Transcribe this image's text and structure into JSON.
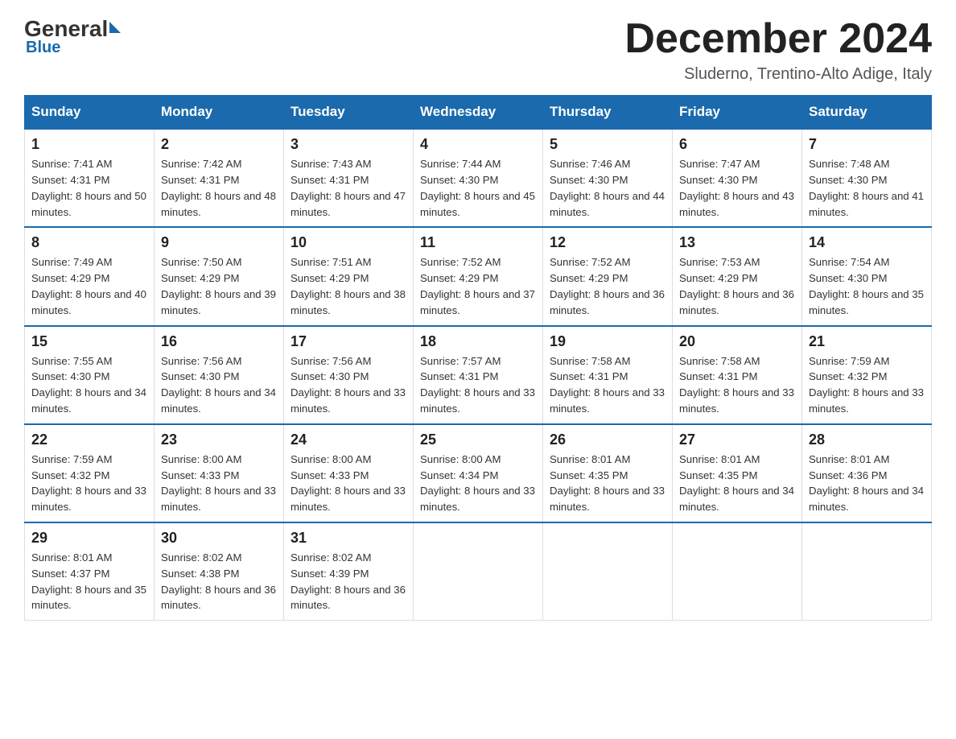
{
  "logo": {
    "general": "General",
    "arrow": "",
    "blue": "Blue"
  },
  "header": {
    "month": "December 2024",
    "location": "Sluderno, Trentino-Alto Adige, Italy"
  },
  "weekdays": [
    "Sunday",
    "Monday",
    "Tuesday",
    "Wednesday",
    "Thursday",
    "Friday",
    "Saturday"
  ],
  "weeks": [
    [
      {
        "day": "1",
        "sunrise": "7:41 AM",
        "sunset": "4:31 PM",
        "daylight": "8 hours and 50 minutes."
      },
      {
        "day": "2",
        "sunrise": "7:42 AM",
        "sunset": "4:31 PM",
        "daylight": "8 hours and 48 minutes."
      },
      {
        "day": "3",
        "sunrise": "7:43 AM",
        "sunset": "4:31 PM",
        "daylight": "8 hours and 47 minutes."
      },
      {
        "day": "4",
        "sunrise": "7:44 AM",
        "sunset": "4:30 PM",
        "daylight": "8 hours and 45 minutes."
      },
      {
        "day": "5",
        "sunrise": "7:46 AM",
        "sunset": "4:30 PM",
        "daylight": "8 hours and 44 minutes."
      },
      {
        "day": "6",
        "sunrise": "7:47 AM",
        "sunset": "4:30 PM",
        "daylight": "8 hours and 43 minutes."
      },
      {
        "day": "7",
        "sunrise": "7:48 AM",
        "sunset": "4:30 PM",
        "daylight": "8 hours and 41 minutes."
      }
    ],
    [
      {
        "day": "8",
        "sunrise": "7:49 AM",
        "sunset": "4:29 PM",
        "daylight": "8 hours and 40 minutes."
      },
      {
        "day": "9",
        "sunrise": "7:50 AM",
        "sunset": "4:29 PM",
        "daylight": "8 hours and 39 minutes."
      },
      {
        "day": "10",
        "sunrise": "7:51 AM",
        "sunset": "4:29 PM",
        "daylight": "8 hours and 38 minutes."
      },
      {
        "day": "11",
        "sunrise": "7:52 AM",
        "sunset": "4:29 PM",
        "daylight": "8 hours and 37 minutes."
      },
      {
        "day": "12",
        "sunrise": "7:52 AM",
        "sunset": "4:29 PM",
        "daylight": "8 hours and 36 minutes."
      },
      {
        "day": "13",
        "sunrise": "7:53 AM",
        "sunset": "4:29 PM",
        "daylight": "8 hours and 36 minutes."
      },
      {
        "day": "14",
        "sunrise": "7:54 AM",
        "sunset": "4:30 PM",
        "daylight": "8 hours and 35 minutes."
      }
    ],
    [
      {
        "day": "15",
        "sunrise": "7:55 AM",
        "sunset": "4:30 PM",
        "daylight": "8 hours and 34 minutes."
      },
      {
        "day": "16",
        "sunrise": "7:56 AM",
        "sunset": "4:30 PM",
        "daylight": "8 hours and 34 minutes."
      },
      {
        "day": "17",
        "sunrise": "7:56 AM",
        "sunset": "4:30 PM",
        "daylight": "8 hours and 33 minutes."
      },
      {
        "day": "18",
        "sunrise": "7:57 AM",
        "sunset": "4:31 PM",
        "daylight": "8 hours and 33 minutes."
      },
      {
        "day": "19",
        "sunrise": "7:58 AM",
        "sunset": "4:31 PM",
        "daylight": "8 hours and 33 minutes."
      },
      {
        "day": "20",
        "sunrise": "7:58 AM",
        "sunset": "4:31 PM",
        "daylight": "8 hours and 33 minutes."
      },
      {
        "day": "21",
        "sunrise": "7:59 AM",
        "sunset": "4:32 PM",
        "daylight": "8 hours and 33 minutes."
      }
    ],
    [
      {
        "day": "22",
        "sunrise": "7:59 AM",
        "sunset": "4:32 PM",
        "daylight": "8 hours and 33 minutes."
      },
      {
        "day": "23",
        "sunrise": "8:00 AM",
        "sunset": "4:33 PM",
        "daylight": "8 hours and 33 minutes."
      },
      {
        "day": "24",
        "sunrise": "8:00 AM",
        "sunset": "4:33 PM",
        "daylight": "8 hours and 33 minutes."
      },
      {
        "day": "25",
        "sunrise": "8:00 AM",
        "sunset": "4:34 PM",
        "daylight": "8 hours and 33 minutes."
      },
      {
        "day": "26",
        "sunrise": "8:01 AM",
        "sunset": "4:35 PM",
        "daylight": "8 hours and 33 minutes."
      },
      {
        "day": "27",
        "sunrise": "8:01 AM",
        "sunset": "4:35 PM",
        "daylight": "8 hours and 34 minutes."
      },
      {
        "day": "28",
        "sunrise": "8:01 AM",
        "sunset": "4:36 PM",
        "daylight": "8 hours and 34 minutes."
      }
    ],
    [
      {
        "day": "29",
        "sunrise": "8:01 AM",
        "sunset": "4:37 PM",
        "daylight": "8 hours and 35 minutes."
      },
      {
        "day": "30",
        "sunrise": "8:02 AM",
        "sunset": "4:38 PM",
        "daylight": "8 hours and 36 minutes."
      },
      {
        "day": "31",
        "sunrise": "8:02 AM",
        "sunset": "4:39 PM",
        "daylight": "8 hours and 36 minutes."
      },
      null,
      null,
      null,
      null
    ]
  ]
}
